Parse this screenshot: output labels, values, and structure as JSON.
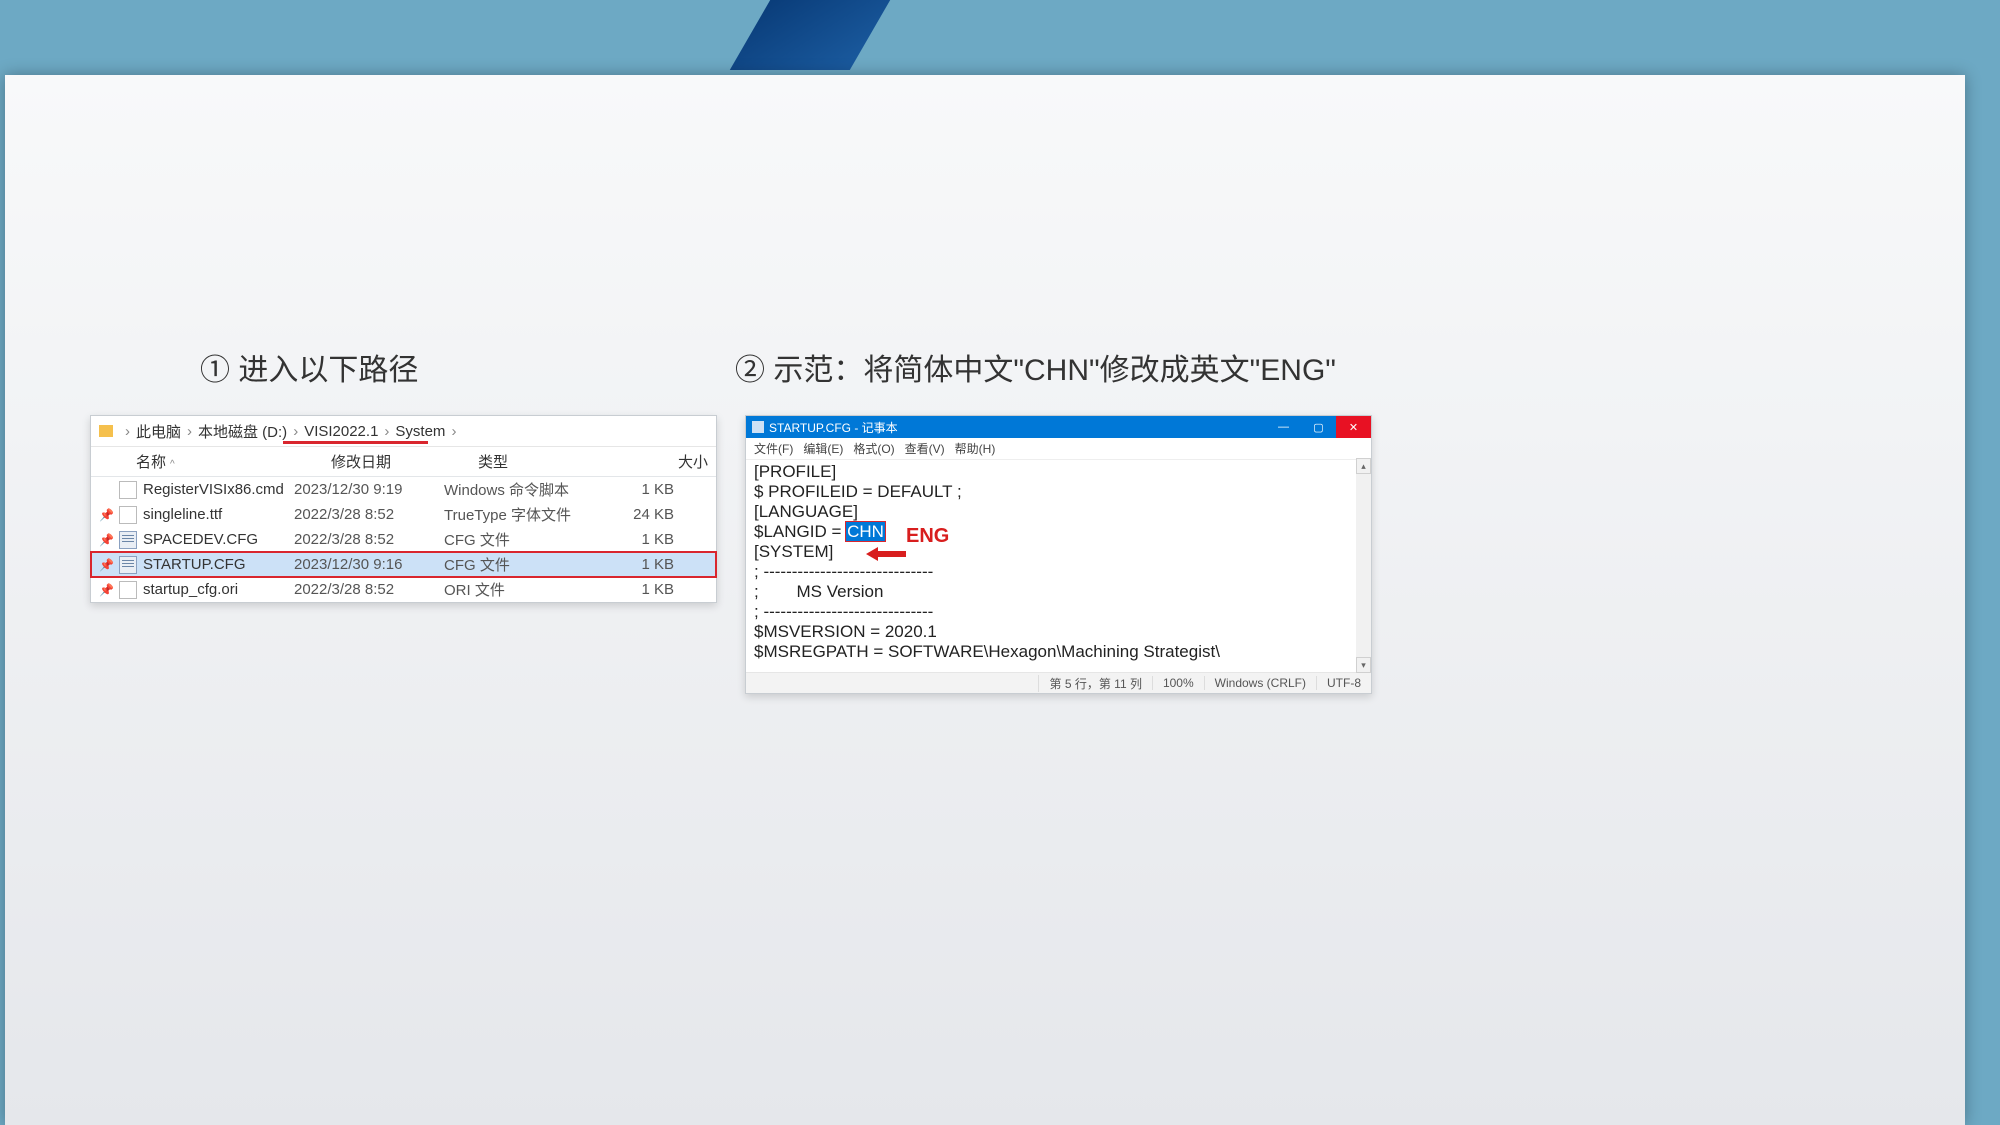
{
  "headings": {
    "h1": "① 进入以下路径",
    "h2": "② 示范：将简体中文\"CHN\"修改成英文\"ENG\""
  },
  "explorer": {
    "breadcrumb": [
      "此电脑",
      "本地磁盘 (D:)",
      "VISI2022.1",
      "System"
    ],
    "columns": {
      "name": "名称",
      "date": "修改日期",
      "type": "类型",
      "size": "大小"
    },
    "rows": [
      {
        "pin": "",
        "name": "RegisterVISIx86.cmd",
        "date": "2023/12/30 9:19",
        "type": "Windows 命令脚本",
        "size": "1 KB",
        "icon": "file",
        "selected": false
      },
      {
        "pin": "📌",
        "name": "singleline.ttf",
        "date": "2022/3/28 8:52",
        "type": "TrueType 字体文件",
        "size": "24 KB",
        "icon": "file",
        "selected": false
      },
      {
        "pin": "📌",
        "name": "SPACEDEV.CFG",
        "date": "2022/3/28 8:52",
        "type": "CFG 文件",
        "size": "1 KB",
        "icon": "cfg",
        "selected": false
      },
      {
        "pin": "📌",
        "name": "STARTUP.CFG",
        "date": "2023/12/30 9:16",
        "type": "CFG 文件",
        "size": "1 KB",
        "icon": "cfg",
        "selected": true
      },
      {
        "pin": "📌",
        "name": "startup_cfg.ori",
        "date": "2022/3/28 8:52",
        "type": "ORI 文件",
        "size": "1 KB",
        "icon": "file",
        "selected": false
      }
    ]
  },
  "notepad": {
    "title": "STARTUP.CFG - 记事本",
    "menus": [
      "文件(F)",
      "编辑(E)",
      "格式(O)",
      "查看(V)",
      "帮助(H)"
    ],
    "arrow_label": "ENG",
    "text": {
      "l1": "[PROFILE]",
      "l2": "$ PROFILEID = DEFAULT ;",
      "l3": "",
      "l4": "[LANGUAGE]",
      "l5_pre": "$LANGID = ",
      "l5_sel": "CHN",
      "l6": "",
      "l7": "[SYSTEM]",
      "l8": "; ------------------------------",
      "l9": ";        MS Version",
      "l10": "; ------------------------------",
      "l11": "$MSVERSION = 2020.1",
      "l12": "$MSREGPATH = SOFTWARE\\Hexagon\\Machining Strategist\\"
    },
    "status": {
      "pos": "第 5 行，第 11 列",
      "zoom": "100%",
      "eol": "Windows (CRLF)",
      "enc": "UTF-8"
    }
  }
}
